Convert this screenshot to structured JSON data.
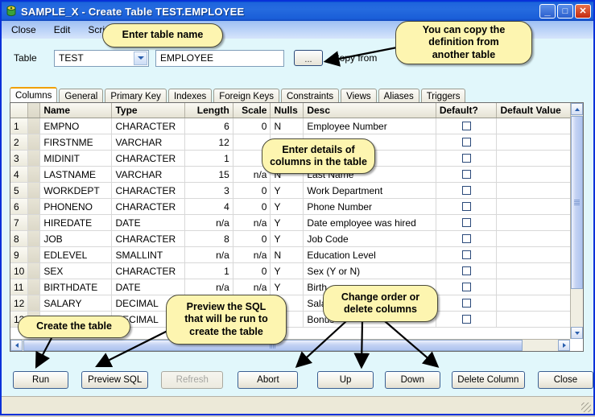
{
  "window": {
    "title": "SAMPLE_X - Create Table TEST.EMPLOYEE",
    "app_icon": "db-app-icon",
    "minimize_glyph": "_",
    "maximize_glyph": "□",
    "close_glyph": "✕"
  },
  "menu": {
    "items": [
      {
        "label": "Close"
      },
      {
        "label": "Edit"
      },
      {
        "label": "Script"
      }
    ]
  },
  "toolbar": {
    "table_label": "Table",
    "schema_value": "TEST",
    "schema_options": [
      "TEST"
    ],
    "table_name_value": "EMPLOYEE",
    "table_name_placeholder": "",
    "browse_label": "...",
    "copy_from_label": "Copy from"
  },
  "tabs": [
    {
      "label": "Columns",
      "active": true
    },
    {
      "label": "General",
      "active": false
    },
    {
      "label": "Primary Key",
      "active": false
    },
    {
      "label": "Indexes",
      "active": false
    },
    {
      "label": "Foreign Keys",
      "active": false
    },
    {
      "label": "Constraints",
      "active": false
    },
    {
      "label": "Views",
      "active": false
    },
    {
      "label": "Aliases",
      "active": false
    },
    {
      "label": "Triggers",
      "active": false
    }
  ],
  "grid": {
    "headers": [
      "",
      "",
      "Name",
      "Type",
      "Length",
      "Scale",
      "Nulls",
      "Desc",
      "Default?",
      "Default Value"
    ],
    "rows": [
      {
        "idx": "1",
        "name": "EMPNO",
        "type": "CHARACTER",
        "length": "6",
        "scale": "0",
        "nulls": "N",
        "desc": "Employee Number",
        "default": false,
        "default_value": ""
      },
      {
        "idx": "2",
        "name": "FIRSTNME",
        "type": "VARCHAR",
        "length": "12",
        "scale": "",
        "nulls": "",
        "desc": "",
        "default": false,
        "default_value": ""
      },
      {
        "idx": "3",
        "name": "MIDINIT",
        "type": "CHARACTER",
        "length": "1",
        "scale": "",
        "nulls": "",
        "desc": "",
        "default": false,
        "default_value": ""
      },
      {
        "idx": "4",
        "name": "LASTNAME",
        "type": "VARCHAR",
        "length": "15",
        "scale": "n/a",
        "nulls": "N",
        "desc": "Last Name",
        "default": false,
        "default_value": ""
      },
      {
        "idx": "5",
        "name": "WORKDEPT",
        "type": "CHARACTER",
        "length": "3",
        "scale": "0",
        "nulls": "Y",
        "desc": "Work Department",
        "default": false,
        "default_value": ""
      },
      {
        "idx": "6",
        "name": "PHONENO",
        "type": "CHARACTER",
        "length": "4",
        "scale": "0",
        "nulls": "Y",
        "desc": "Phone Number",
        "default": false,
        "default_value": ""
      },
      {
        "idx": "7",
        "name": "HIREDATE",
        "type": "DATE",
        "length": "n/a",
        "scale": "n/a",
        "nulls": "Y",
        "desc": "Date employee was hired",
        "default": false,
        "default_value": ""
      },
      {
        "idx": "8",
        "name": "JOB",
        "type": "CHARACTER",
        "length": "8",
        "scale": "0",
        "nulls": "Y",
        "desc": "Job Code",
        "default": false,
        "default_value": ""
      },
      {
        "idx": "9",
        "name": "EDLEVEL",
        "type": "SMALLINT",
        "length": "n/a",
        "scale": "n/a",
        "nulls": "N",
        "desc": "Education Level",
        "default": false,
        "default_value": ""
      },
      {
        "idx": "10",
        "name": "SEX",
        "type": "CHARACTER",
        "length": "1",
        "scale": "0",
        "nulls": "Y",
        "desc": "Sex (Y or N)",
        "default": false,
        "default_value": ""
      },
      {
        "idx": "11",
        "name": "BIRTHDATE",
        "type": "DATE",
        "length": "n/a",
        "scale": "n/a",
        "nulls": "Y",
        "desc": "Birth",
        "default": false,
        "default_value": ""
      },
      {
        "idx": "12",
        "name": "SALARY",
        "type": "DECIMAL",
        "length": "",
        "scale": "",
        "nulls": "",
        "desc": "Sala",
        "default": false,
        "default_value": ""
      },
      {
        "idx": "13",
        "name": "",
        "type": "DECIMAL",
        "length": "",
        "scale": "",
        "nulls": "",
        "desc": "Bonus",
        "default": false,
        "default_value": ""
      }
    ]
  },
  "buttons": [
    {
      "label": "Run",
      "disabled": false
    },
    {
      "label": "Preview SQL",
      "disabled": false
    },
    {
      "label": "Refresh",
      "disabled": true
    },
    {
      "label": "Abort",
      "disabled": false
    },
    {
      "label": "Up",
      "disabled": false
    },
    {
      "label": "Down",
      "disabled": false
    },
    {
      "label": "Delete Column",
      "disabled": false
    },
    {
      "label": "Close",
      "disabled": false
    }
  ],
  "callouts": [
    {
      "id": "enter-table-name",
      "text": "Enter table name"
    },
    {
      "id": "copy-definition",
      "text": "You can copy the\ndefinition from\nanother table"
    },
    {
      "id": "enter-column-details",
      "text": "Enter details of\ncolumns in the table"
    },
    {
      "id": "create-the-table",
      "text": "Create the table"
    },
    {
      "id": "preview-sql",
      "text": "Preview the SQL\nthat will be run to\ncreate the table"
    },
    {
      "id": "change-order",
      "text": "Change order or\ndelete columns"
    }
  ],
  "colors": {
    "title_bar": "#1f65dd",
    "client_bg": "#e1f7fb",
    "callout_bg": "#fdf5b0",
    "active_tab_accent": "#f0a000"
  }
}
